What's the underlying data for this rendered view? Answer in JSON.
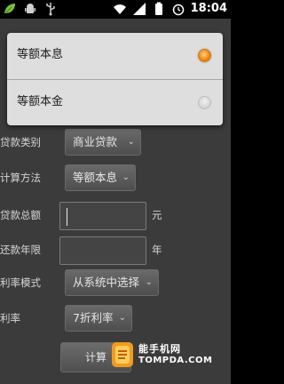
{
  "status_bar": {
    "time": "18:04",
    "icons": [
      "leaf-app-icon",
      "android-icon",
      "usb-icon",
      "wifi-icon",
      "signal-icon",
      "battery-icon",
      "alarm-icon"
    ]
  },
  "form": {
    "loan_type": {
      "label": "贷款类别",
      "value": "商业贷款"
    },
    "calc_method": {
      "label": "计算方法",
      "value": "等额本息"
    },
    "loan_total": {
      "label": "贷款总额",
      "value": "",
      "unit": "元"
    },
    "loan_years": {
      "label": "还款年限",
      "value": "",
      "unit": "年"
    },
    "rate_mode": {
      "label": "利率模式",
      "value": "从系统中选择"
    },
    "rate": {
      "label": "利率",
      "value": "7折利率"
    },
    "calculate_button": "计算"
  },
  "dialog": {
    "options": [
      {
        "label": "等额本息",
        "selected": true
      },
      {
        "label": "等额本金",
        "selected": false
      }
    ],
    "accent_color": "#f08a12"
  },
  "watermark": {
    "line1": "能手机网",
    "line2": "TOMPDA.COM"
  }
}
